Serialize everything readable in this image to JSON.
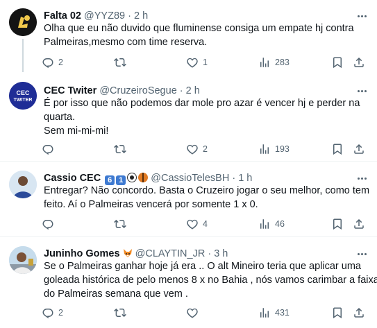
{
  "tweets": [
    {
      "name": "Falta 02",
      "handle": "@YYZ89",
      "separator": "·",
      "time": "2 h",
      "text_lines": [
        "Olha que eu não duvido que fluminense consiga um empate hj contra",
        "Palmeiras,mesmo com time reserva."
      ],
      "replies": "2",
      "retweets": "",
      "likes": "1",
      "views": "283"
    },
    {
      "name": "CEC Twiter",
      "handle": "@CruzeiroSegue",
      "separator": "·",
      "time": "2 h",
      "avatar_text": "CEC TWITER",
      "text_lines": [
        "É por isso que não podemos dar mole pro azar é vencer hj e perder na",
        "quarta.",
        "Sem mi-mi-mi!"
      ],
      "replies": "",
      "retweets": "",
      "likes": "2",
      "views": "193"
    },
    {
      "name": "Cassio CEC",
      "badge_6": "6",
      "badge_1": "1",
      "handle": "@CassioTelesBH",
      "separator": "·",
      "time": "1 h",
      "text_lines": [
        "Entregar? Não concordo. Basta o Cruzeiro jogar o seu melhor, como tem",
        "feito. Aí o Palmeiras vencerá por somente 1 x 0."
      ],
      "replies": "",
      "retweets": "",
      "likes": "4",
      "views": "46"
    },
    {
      "name": "Juninho Gomes",
      "handle": "@CLAYTIN_JR",
      "separator": "·",
      "time": "3 h",
      "text_lines": [
        "Se o Palmeiras ganhar hoje já era ..  O alt Mineiro teria que aplicar uma",
        "goleada histórica de pelo menos 8 x no Bahia , nós vamos carimbar a faixa",
        "do Palmeiras semana que vem ."
      ],
      "replies": "2",
      "retweets": "",
      "likes": "",
      "views": "431"
    }
  ],
  "colors": {
    "icon": "#536471",
    "divider": "#eff3f4",
    "badge": "#3e7ad1",
    "thread_line": "#cfd9de"
  },
  "icons": [
    "more-icon",
    "reply-icon",
    "retweet-icon",
    "like-icon",
    "views-icon",
    "bookmark-icon",
    "share-icon"
  ]
}
